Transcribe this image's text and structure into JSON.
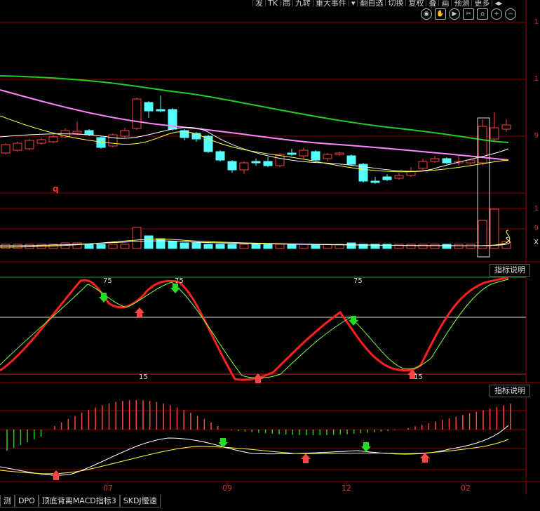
{
  "toolbar": {
    "items": [
      "发",
      "TK",
      "商",
      "九转",
      "重大事件",
      "▾",
      "翻自选",
      "切换",
      "复权",
      "叠",
      "画",
      "预测",
      "更多",
      "◂▸"
    ]
  },
  "icons": [
    "eye-icon",
    "hand-icon",
    "play-icon",
    "scissors-icon",
    "home-icon",
    "zoom-in-icon",
    "zoom-out-icon"
  ],
  "panels": {
    "kdj_button": "指标说明",
    "macd_button": "指标说明",
    "kdj_levels": {
      "top": "75",
      "top2": "75",
      "top3": "75",
      "bottom": "15",
      "bottom2": "15"
    },
    "main_marker": "q"
  },
  "xaxis": {
    "ticks": [
      "07",
      "09",
      "12",
      "02"
    ]
  },
  "right_axis": {
    "p1": "1",
    "p2": "1",
    "p3": "9",
    "v1": "1",
    "v2": "9",
    "v3": "X"
  },
  "bottom_tabs": [
    "测",
    "DPO",
    "顶底背离MACD指标3",
    "SKDJ慢速"
  ],
  "colors": {
    "up": "#ff4040",
    "down": "#54ffff",
    "ma_green": "#22cc22",
    "ma_pink": "#ff88ff",
    "ma_white": "#ffffff",
    "ma_yellow": "#ffff44",
    "k_line": "#ff2020",
    "d_line": "#7fff3f",
    "grid": "#8b0000"
  }
}
